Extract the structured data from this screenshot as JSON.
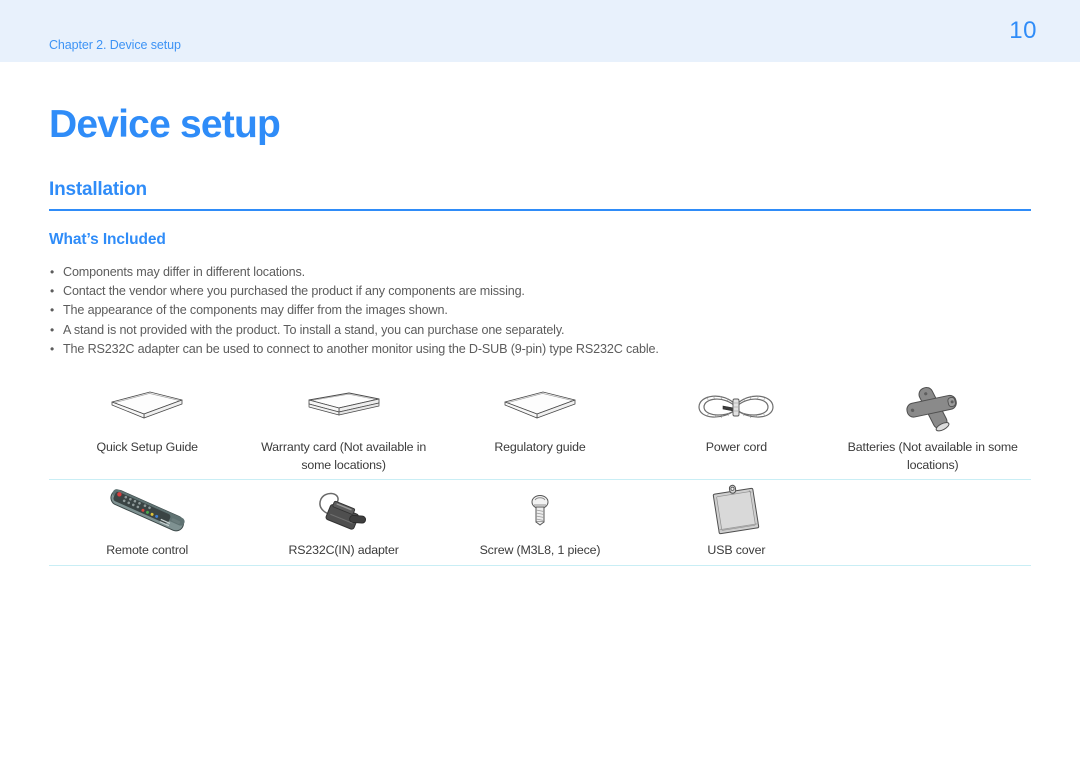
{
  "header": {
    "chapter": "Chapter 2. Device setup",
    "page_number": "10"
  },
  "document": {
    "title": "Device setup",
    "section": "Installation",
    "subsection": "What’s Included"
  },
  "notes": [
    "Components may differ in different locations.",
    "Contact the vendor where you purchased the product if any components are missing.",
    "The appearance of the components may differ from the images shown.",
    "A stand is not provided with the product. To install a stand, you can purchase one separately.",
    "The RS232C adapter can be used to connect to another monitor using the D-SUB (9-pin) type RS232C cable."
  ],
  "components": {
    "rows": [
      [
        {
          "icon": "quick-setup-guide-icon",
          "label": "Quick Setup Guide"
        },
        {
          "icon": "warranty-card-icon",
          "label": "Warranty card (Not available in some locations)"
        },
        {
          "icon": "regulatory-guide-icon",
          "label": "Regulatory guide"
        },
        {
          "icon": "power-cord-icon",
          "label": "Power cord"
        },
        {
          "icon": "batteries-icon",
          "label": "Batteries (Not available in some locations)"
        }
      ],
      [
        {
          "icon": "remote-control-icon",
          "label": "Remote control"
        },
        {
          "icon": "rs232c-adapter-icon",
          "label": "RS232C(IN) adapter"
        },
        {
          "icon": "screw-icon",
          "label": "Screw (M3L8, 1 piece)"
        },
        {
          "icon": "usb-cover-icon",
          "label": "USB cover"
        },
        {
          "icon": "",
          "label": ""
        }
      ]
    ]
  },
  "colors": {
    "accent": "#2f8cf8",
    "header_band": "#e8f1fc",
    "rule": "#c9eef5",
    "body_text": "#5c5c5c"
  }
}
